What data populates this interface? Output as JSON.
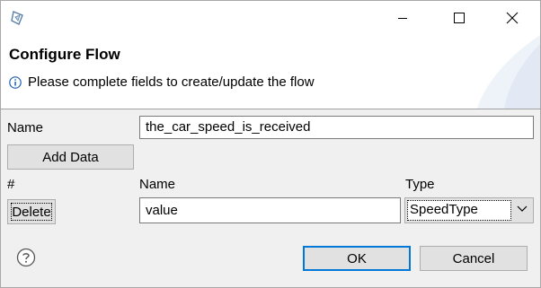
{
  "window": {
    "minimize_icon": "minimize-icon",
    "maximize_icon": "maximize-icon",
    "close_icon": "close-icon"
  },
  "header": {
    "title": "Configure Flow",
    "message": "Please complete fields to create/update the flow",
    "message_icon": "info-icon"
  },
  "form": {
    "name_label": "Name",
    "name_value": "the_car_speed_is_received",
    "add_data_label": "Add Data"
  },
  "data_table": {
    "columns": {
      "index": "#",
      "name": "Name",
      "type": "Type"
    },
    "rows": [
      {
        "delete_label": "Delete",
        "name_value": "value",
        "type_value": "SpeedType"
      }
    ]
  },
  "footer": {
    "help_icon": "help-icon",
    "ok_label": "OK",
    "cancel_label": "Cancel"
  },
  "colors": {
    "default_button_border": "#0078d7",
    "info_icon": "#1a5fb4",
    "dialog_bg": "#f0f0f0"
  }
}
